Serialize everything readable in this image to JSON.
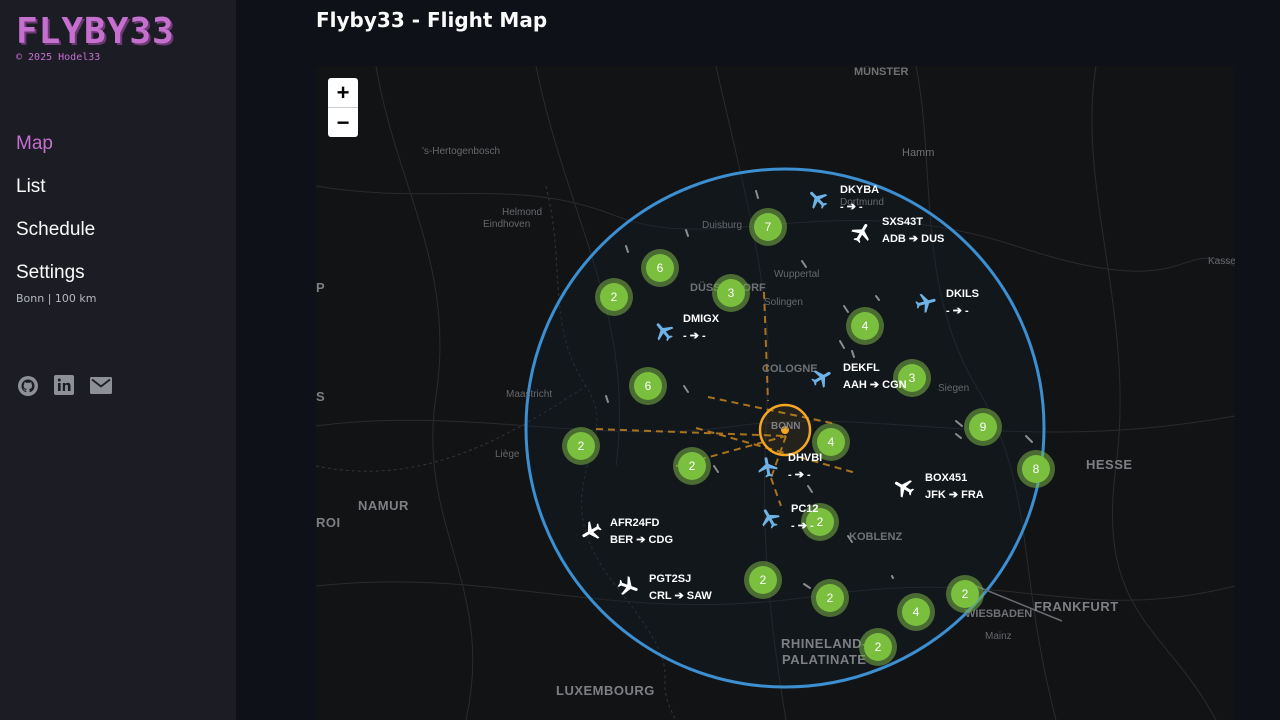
{
  "sidebar": {
    "logo": "FLYBY33",
    "copyright": "© 2025 Hodel33",
    "nav": [
      {
        "label": "Map",
        "active": true
      },
      {
        "label": "List"
      },
      {
        "label": "Schedule"
      },
      {
        "label": "Settings"
      }
    ],
    "settings_sub": "Bonn | 100 km",
    "social": [
      "github-icon",
      "linkedin-icon",
      "mail-icon"
    ]
  },
  "page": {
    "title": "Flyby33 - Flight Map"
  },
  "map": {
    "zoom_in": "+",
    "zoom_out": "−",
    "center": "BONN",
    "colors": {
      "radius_circle": "#3c8fd1",
      "home_marker": "#f5a623",
      "cluster": "#7bbf3e",
      "plane": "#6fb3e6"
    },
    "places": [
      {
        "name": "MÜNSTER",
        "kind": "city"
      },
      {
        "name": "'s-Hertogenbosch",
        "kind": "town"
      },
      {
        "name": "Hamm",
        "kind": "city"
      },
      {
        "name": "Helmond",
        "kind": "town"
      },
      {
        "name": "Eindhoven",
        "kind": "town"
      },
      {
        "name": "Dortmund",
        "kind": "town"
      },
      {
        "name": "Duisburg",
        "kind": "town"
      },
      {
        "name": "Wuppertal",
        "kind": "town"
      },
      {
        "name": "Solingen",
        "kind": "town"
      },
      {
        "name": "DÜSSELDORF",
        "kind": "city"
      },
      {
        "name": "COLOGNE",
        "kind": "city"
      },
      {
        "name": "Maastricht",
        "kind": "town"
      },
      {
        "name": "Liège",
        "kind": "town"
      },
      {
        "name": "Siegen",
        "kind": "town"
      },
      {
        "name": "Kassel",
        "kind": "town"
      },
      {
        "name": "HESSE",
        "kind": "region"
      },
      {
        "name": "NAMUR",
        "kind": "region"
      },
      {
        "name": "ROI",
        "kind": "region"
      },
      {
        "name": "KOBLENZ",
        "kind": "city"
      },
      {
        "name": "WIESBADEN",
        "kind": "city"
      },
      {
        "name": "FRANKFURT",
        "kind": "region"
      },
      {
        "name": "Mainz",
        "kind": "town"
      },
      {
        "name": "RHINELAND-",
        "kind": "region"
      },
      {
        "name": "PALATINATE",
        "kind": "region"
      },
      {
        "name": "LUXEMBOURG",
        "kind": "region"
      },
      {
        "name": "P",
        "kind": "region"
      },
      {
        "name": "S",
        "kind": "region"
      }
    ],
    "clusters": [
      "7",
      "6",
      "3",
      "2",
      "4",
      "6",
      "3",
      "9",
      "8",
      "2",
      "2",
      "4",
      "2",
      "2",
      "2",
      "4",
      "2",
      "2"
    ],
    "flights": [
      {
        "callsign": "DKYBA",
        "route": "- ➔ -"
      },
      {
        "callsign": "SXS43T",
        "route": "ADB ➔ DUS"
      },
      {
        "callsign": "DKILS",
        "route": "- ➔ -"
      },
      {
        "callsign": "DMIGX",
        "route": "- ➔ -"
      },
      {
        "callsign": "DEKFL",
        "route": "AAH ➔ CGN"
      },
      {
        "callsign": "DHVBI",
        "route": "- ➔ -"
      },
      {
        "callsign": "BOX451",
        "route": "JFK ➔ FRA"
      },
      {
        "callsign": "PC12",
        "route": "- ➔ -"
      },
      {
        "callsign": "AFR24FD",
        "route": "BER ➔ CDG"
      },
      {
        "callsign": "PGT2SJ",
        "route": "CRL ➔ SAW"
      }
    ]
  }
}
